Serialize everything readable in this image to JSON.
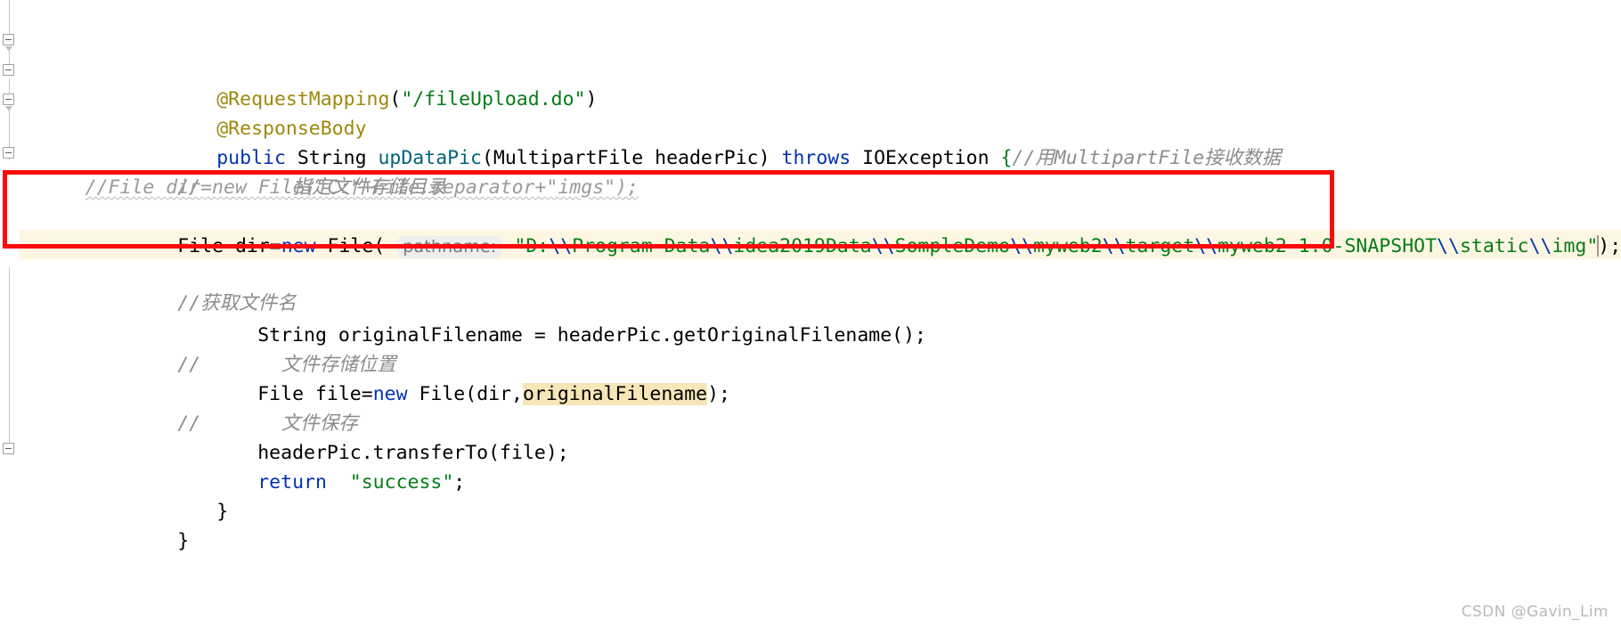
{
  "editor": {
    "app": "IntelliJ IDEA code editor",
    "language": "Java",
    "font_size_px": 21.5,
    "colors": {
      "background": "#ffffff",
      "text": "#000000",
      "keyword": "#0033b3",
      "annotation": "#9e880d",
      "string": "#067d17",
      "string_escape": "#0037a6",
      "method_declaration": "#00627a",
      "comment": "#8c8c8c",
      "param_hint_background": "#eeeeee",
      "param_hint_text": "#787878",
      "identifier_highlight": "#f6e6b8",
      "line_band": "#fdf6e3",
      "annotation_box": "#fa0a0a",
      "gutter_fold": "#a0a0a0",
      "watermark": "#b9b9b9"
    }
  },
  "code": {
    "line1": {
      "annotation": "@RequestMapping",
      "paren_open": "(",
      "string": "\"/fileUpload.do\"",
      "paren_close": ")"
    },
    "line2": {
      "annotation": "@ResponseBody"
    },
    "line3": {
      "kw_public": "public",
      "type_string": " String ",
      "method": "upDataPic",
      "params": "(MultipartFile headerPic) ",
      "kw_throws": "throws",
      "exception": " IOException ",
      "brace": "{",
      "comment": "//用MultipartFile接收数据"
    },
    "line4": {
      "comment_slashes": "//",
      "comment_text": "        指定文件存储目录"
    },
    "line5": {
      "commented_out": "//File dir=new File(\"C:\"+File.separator+\"imgs\");"
    },
    "line6": {
      "decl": "File dir=",
      "kw_new": "new",
      "ctor": " File( ",
      "param_hint": "pathname:",
      "path_string": "\"D:\\\\Program Data\\\\idea2019Data\\\\SompleDemo\\\\myweb2\\\\target\\\\myweb2-1.0-SNAPSHOT\\\\static\\\\img\"",
      "tail": ");",
      "path_plain_value": "D:\\Program Data\\idea2019Data\\SompleDemo\\myweb2\\target\\myweb2-1.0-SNAPSHOT\\static\\img"
    },
    "line7": {
      "comment": "//获取文件名"
    },
    "line8": {
      "text": "String originalFilename = headerPic.getOriginalFilename();"
    },
    "line9": {
      "comment_slashes": "//",
      "comment_text": "       文件存储位置"
    },
    "line10": {
      "prefix": "File file=",
      "kw_new": "new",
      "ctor": " File(dir,",
      "highlighted_ident": "originalFilename",
      "tail": ");"
    },
    "line11": {
      "comment_slashes": "//",
      "comment_text": "       文件保存"
    },
    "line12": {
      "text": "headerPic.transferTo(file);"
    },
    "line13": {
      "kw_return": "return",
      "string": "  \"success\"",
      "tail": ";"
    },
    "line14": {
      "brace": "}"
    },
    "line15": {
      "brace": "}"
    }
  },
  "watermark": {
    "text": "CSDN @Gavin_Lim"
  },
  "annotation_box": {
    "label": "red-highlight-rectangle",
    "targets_line": "File dir=new File( pathname: \"D:\\\\Program Data\\\\idea2019Data\\\\SompleDemo\\\\myweb2\\\\target\\\\myweb2-1.0-SNAPSHOT\\\\static\\\\img\");"
  }
}
